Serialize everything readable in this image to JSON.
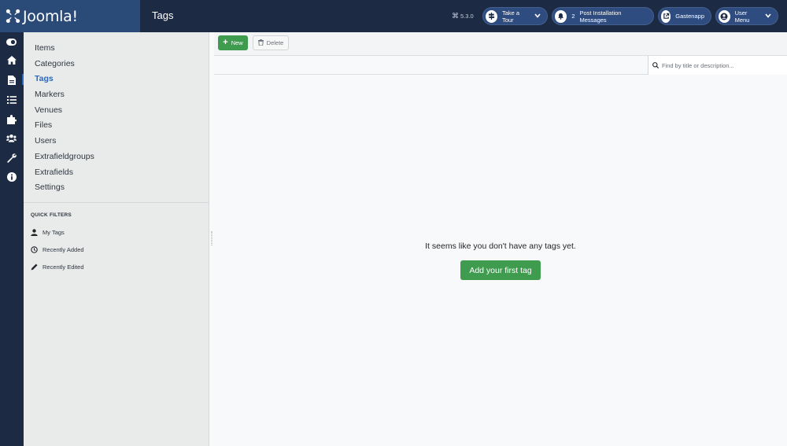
{
  "brand": {
    "name": "Joomla!"
  },
  "header": {
    "title": "Tags",
    "version": "5.3.0",
    "take_tour": "Take a Tour",
    "notifications_count": "2",
    "post_install": "Post Installation Messages",
    "site_link": "Gastenapp",
    "user_menu": "User Menu"
  },
  "rail": {
    "icons": [
      "toggle-icon",
      "home-icon",
      "file-icon",
      "list-icon",
      "puzzle-icon",
      "users-icon",
      "wrench-icon",
      "info-icon"
    ]
  },
  "sidebar": {
    "items": [
      {
        "label": "Items",
        "active": false
      },
      {
        "label": "Categories",
        "active": false
      },
      {
        "label": "Tags",
        "active": true
      },
      {
        "label": "Markers",
        "active": false
      },
      {
        "label": "Venues",
        "active": false
      },
      {
        "label": "Files",
        "active": false
      },
      {
        "label": "Users",
        "active": false
      },
      {
        "label": "Extrafieldgroups",
        "active": false
      },
      {
        "label": "Extrafields",
        "active": false
      },
      {
        "label": "Settings",
        "active": false
      }
    ],
    "quick_filters_title": "QUICK FILTERS",
    "quick_filters": [
      {
        "label": "My Tags",
        "icon": "user-icon"
      },
      {
        "label": "Recently Added",
        "icon": "clock-icon"
      },
      {
        "label": "Recently Edited",
        "icon": "pencil-icon"
      }
    ]
  },
  "toolbar": {
    "new_label": "New",
    "delete_label": "Delete"
  },
  "search": {
    "placeholder": "Find by title or description..."
  },
  "main": {
    "empty_message": "It seems like you don't have any tags yet.",
    "add_button": "Add your first tag"
  },
  "colors": {
    "header_bg": "#1c2a43",
    "logo_bg": "#2a4a78",
    "accent": "#2a69b8",
    "success": "#3f9c4f"
  }
}
